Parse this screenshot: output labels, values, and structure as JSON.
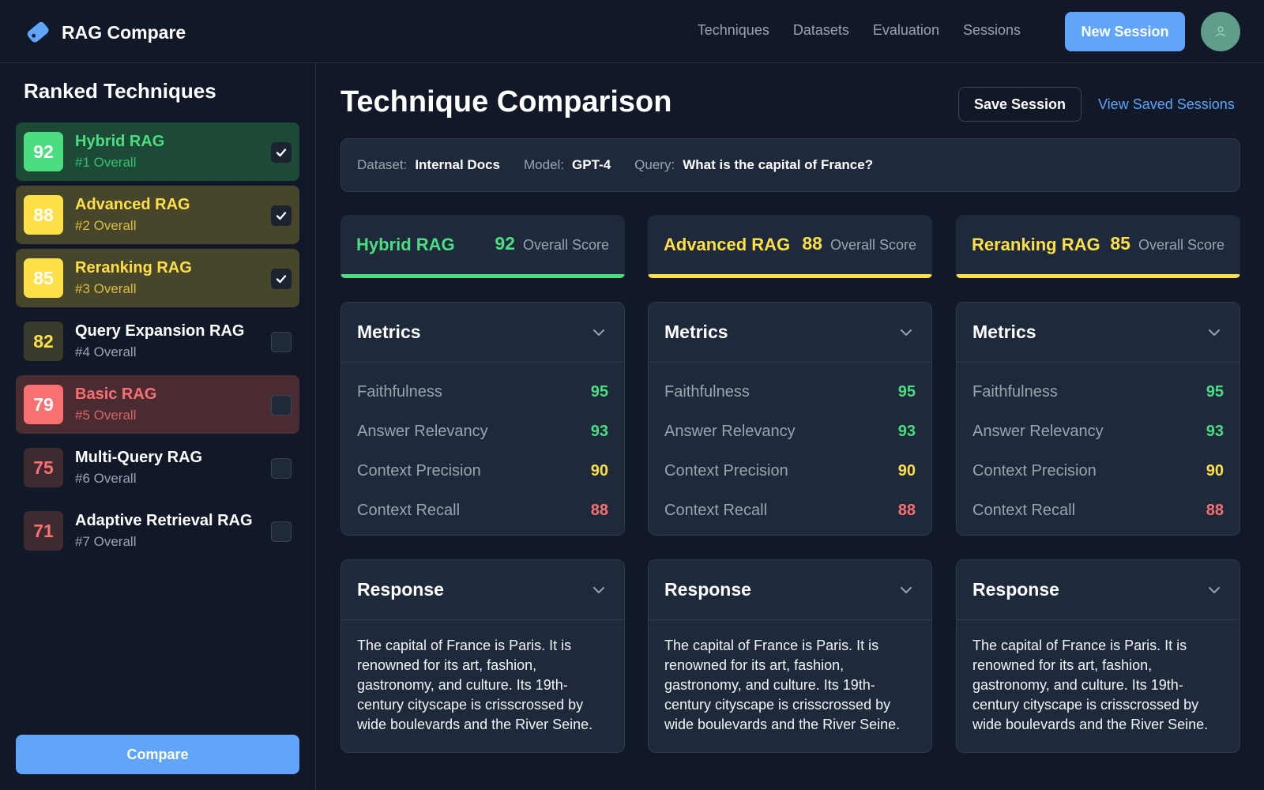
{
  "app": {
    "title": "RAG Compare"
  },
  "nav": [
    "Techniques",
    "Datasets",
    "Evaluation",
    "Sessions"
  ],
  "header": {
    "new_session": "New Session"
  },
  "sidebar": {
    "title": "Ranked Techniques",
    "items": [
      {
        "score": "92",
        "name": "Hybrid RAG",
        "rank": "#1 Overall",
        "checked": true,
        "tone": "green"
      },
      {
        "score": "88",
        "name": "Advanced RAG",
        "rank": "#2 Overall",
        "checked": true,
        "tone": "yellow"
      },
      {
        "score": "85",
        "name": "Reranking RAG",
        "rank": "#3 Overall",
        "checked": true,
        "tone": "yellow"
      },
      {
        "score": "82",
        "name": "Query Expansion RAG",
        "rank": "#4 Overall",
        "checked": false,
        "tone": "plain-yellow"
      },
      {
        "score": "79",
        "name": "Basic RAG",
        "rank": "#5 Overall",
        "checked": false,
        "tone": "red"
      },
      {
        "score": "75",
        "name": "Multi-Query RAG",
        "rank": "#6 Overall",
        "checked": false,
        "tone": "plain-red"
      },
      {
        "score": "71",
        "name": "Adaptive Retrieval RAG",
        "rank": "#7 Overall",
        "checked": false,
        "tone": "plain-red"
      }
    ],
    "compare": "Compare"
  },
  "main": {
    "title": "Technique Comparison",
    "save": "Save Session",
    "view_saved": "View Saved Sessions",
    "query": {
      "dataset_label": "Dataset:",
      "dataset": "Internal Docs",
      "model_label": "Model:",
      "model": "GPT-4",
      "query_label": "Query:",
      "query": "What is the capital of France?"
    },
    "columns": [
      {
        "name": "Hybrid RAG",
        "score": "92",
        "score_label": "Overall Score",
        "accent": "#4ade80",
        "metrics_title": "Metrics",
        "metrics": [
          {
            "name": "Faithfulness",
            "value": "95",
            "color": "#4ade80"
          },
          {
            "name": "Answer Relevancy",
            "value": "93",
            "color": "#4ade80"
          },
          {
            "name": "Context Precision",
            "value": "90",
            "color": "#fde047"
          },
          {
            "name": "Context Recall",
            "value": "88",
            "color": "#f87171"
          }
        ],
        "response_title": "Response",
        "response": "The capital of France is Paris. It is renowned for its art, fashion, gastronomy, and culture. Its 19th-century cityscape is crisscrossed by wide boulevards and the River Seine."
      },
      {
        "name": "Advanced RAG",
        "score": "88",
        "score_label": "Overall Score",
        "accent": "#fde047",
        "metrics_title": "Metrics",
        "metrics": [
          {
            "name": "Faithfulness",
            "value": "95",
            "color": "#4ade80"
          },
          {
            "name": "Answer Relevancy",
            "value": "93",
            "color": "#4ade80"
          },
          {
            "name": "Context Precision",
            "value": "90",
            "color": "#fde047"
          },
          {
            "name": "Context Recall",
            "value": "88",
            "color": "#f87171"
          }
        ],
        "response_title": "Response",
        "response": "The capital of France is Paris. It is renowned for its art, fashion, gastronomy, and culture. Its 19th-century cityscape is crisscrossed by wide boulevards and the River Seine."
      },
      {
        "name": "Reranking RAG",
        "score": "85",
        "score_label": "Overall Score",
        "accent": "#fde047",
        "metrics_title": "Metrics",
        "metrics": [
          {
            "name": "Faithfulness",
            "value": "95",
            "color": "#4ade80"
          },
          {
            "name": "Answer Relevancy",
            "value": "93",
            "color": "#4ade80"
          },
          {
            "name": "Context Precision",
            "value": "90",
            "color": "#fde047"
          },
          {
            "name": "Context Recall",
            "value": "88",
            "color": "#f87171"
          }
        ],
        "response_title": "Response",
        "response": "The capital of France is Paris. It is renowned for its art, fashion, gastronomy, and culture. Its 19th-century cityscape is crisscrossed by wide boulevards and the River Seine."
      }
    ]
  },
  "colors": {
    "accent": "#60a5fa",
    "green": "#4ade80",
    "yellow": "#fde047",
    "red": "#f87171",
    "background": "#111827"
  },
  "icons": [
    "tag-icon",
    "avatar-icon",
    "check-icon",
    "chevron-down-icon"
  ]
}
